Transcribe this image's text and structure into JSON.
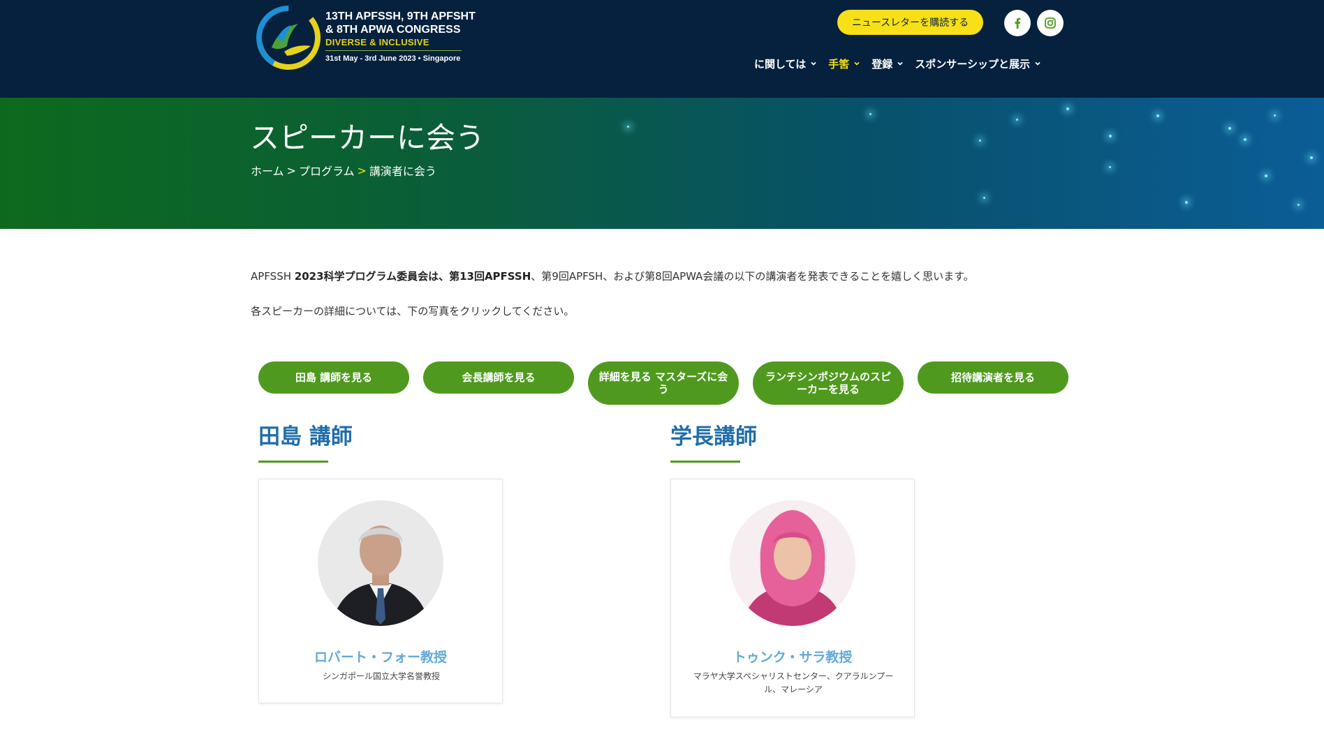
{
  "header": {
    "logo": {
      "line1": "13TH APFSSH, 9TH APFSHT",
      "line2": "& 8TH APWA CONGRESS",
      "line3": "DIVERSE & INCLUSIVE",
      "line4": "31st May - 3rd June 2023 • Singapore"
    },
    "newsletter_label": "ニュースレターを購読する",
    "social": [
      {
        "icon": "facebook-icon",
        "glyph": "f"
      },
      {
        "icon": "instagram-icon"
      }
    ],
    "nav": [
      {
        "label": "に関しては",
        "active": false
      },
      {
        "label": "手筈",
        "active": true
      },
      {
        "label": "登録",
        "active": false
      },
      {
        "label": "スポンサーシップと展示",
        "active": false
      }
    ],
    "colors": {
      "background": "#05213d",
      "accent": "#f7e017"
    }
  },
  "hero": {
    "title": "スピーカーに会う",
    "breadcrumb": {
      "home": "ホーム",
      "sep1": ">",
      "program": "プログラム",
      "sep2": ">",
      "current": "講演者に会う"
    }
  },
  "intro": {
    "p1_part1": "APFSSH ",
    "p1_bold": "2023科学プログラム委員会は、第13回APFSSH",
    "p1_part2": "、第9回APFSH、および第8回APWA会議の以下の講演者を発表できることを嬉しく思います。",
    "p2": "各スピーカーの詳細については、下の写真をクリックしてください。"
  },
  "category_buttons": [
    {
      "label": "田島 講師を見る"
    },
    {
      "label": "会長講師を見る"
    },
    {
      "label": "詳細を見る マスターズに会う"
    },
    {
      "label": "ランチシンポジウムのスピーカーを見る"
    },
    {
      "label": "招待講演者を見る"
    }
  ],
  "sections": [
    {
      "title": "田島 講師",
      "speaker": {
        "name": "ロバート・フォー教授",
        "affiliation": "シンガポール国立大学名誉教授"
      }
    },
    {
      "title": "学長講師",
      "speaker": {
        "name": "トゥンク・サラ教授",
        "affiliation": "マラヤ大学スペシャリストセンター、クアラルンプール、マレーシア"
      }
    }
  ],
  "colors": {
    "button_green": "#4f9a1e",
    "section_title": "#1f6da9",
    "speaker_name": "#63a9d9"
  }
}
